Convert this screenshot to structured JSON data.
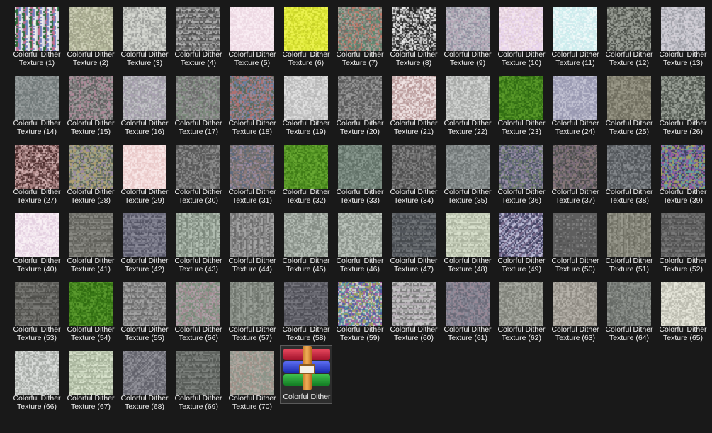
{
  "window": {
    "background": "#191919",
    "text_color": "#f0f0f0"
  },
  "files": [
    {
      "line1": "Colorful Dither",
      "line2": "Texture (1)",
      "palette": [
        "#d8d8e0",
        "#2a6b3a",
        "#c07090",
        "#7080c0",
        "#f0f0f0"
      ],
      "style": "vstripe"
    },
    {
      "line1": "Colorful Dither",
      "line2": "Texture (2)",
      "palette": [
        "#b8bca0",
        "#9ea088",
        "#cfd0b8",
        "#a8aa90"
      ],
      "style": "noise"
    },
    {
      "line1": "Colorful Dither",
      "line2": "Texture (3)",
      "palette": [
        "#c8cac4",
        "#9a9c98",
        "#d8dad4",
        "#b0b2ae"
      ],
      "style": "noise"
    },
    {
      "line1": "Colorful Dither",
      "line2": "Texture (4)",
      "palette": [
        "#8a8a8a",
        "#6a6a6a",
        "#b0b0b0",
        "#505050"
      ],
      "style": "hstripe"
    },
    {
      "line1": "Colorful Dither",
      "line2": "Texture (5)",
      "palette": [
        "#f6e6ee",
        "#f0dce6",
        "#faeef4",
        "#ecd8e2"
      ],
      "style": "noise"
    },
    {
      "line1": "Colorful Dither",
      "line2": "Texture (6)",
      "palette": [
        "#e4ee40",
        "#d6e030",
        "#eef452",
        "#c8d228"
      ],
      "style": "noise"
    },
    {
      "line1": "Colorful Dither",
      "line2": "Texture (7)",
      "palette": [
        "#8a8a80",
        "#6e7068",
        "#a6a098",
        "#c07868",
        "#5a8a70"
      ],
      "style": "noise"
    },
    {
      "line1": "Colorful Dither",
      "line2": "Texture (8)",
      "palette": [
        "#202020",
        "#f0f0f0",
        "#8a8a8a",
        "#404040",
        "#c8c8c8"
      ],
      "style": "noise"
    },
    {
      "line1": "Colorful Dither",
      "line2": "Texture (9)",
      "palette": [
        "#a8a8b0",
        "#c0c0c8",
        "#9090a0",
        "#b8a8b8"
      ],
      "style": "noise"
    },
    {
      "line1": "Colorful Dither",
      "line2": "Texture (10)",
      "palette": [
        "#ecdae6",
        "#f4e6ee",
        "#e0ccd8",
        "#e8d4ee"
      ],
      "style": "noise"
    },
    {
      "line1": "Colorful Dither",
      "line2": "Texture (11)",
      "palette": [
        "#e0f4f4",
        "#cceeee",
        "#f0fafa",
        "#d0e8ec"
      ],
      "style": "noise"
    },
    {
      "line1": "Colorful Dither",
      "line2": "Texture (12)",
      "palette": [
        "#6a6e66",
        "#8a8e86",
        "#4a4e48",
        "#a0a49c"
      ],
      "style": "noise"
    },
    {
      "line1": "Colorful Dither",
      "line2": "Texture (13)",
      "palette": [
        "#b8b8c0",
        "#c8c8d0",
        "#a0a0a8",
        "#d4d0d8"
      ],
      "style": "noise"
    },
    {
      "line1": "Colorful Dither",
      "line2": "Texture (14)",
      "palette": [
        "#8a9090",
        "#7a8080",
        "#9aa0a0",
        "#707878"
      ],
      "style": "noise"
    },
    {
      "line1": "Colorful Dither",
      "line2": "Texture (15)",
      "palette": [
        "#7a7878",
        "#9a9898",
        "#606060",
        "#b08a9a"
      ],
      "style": "noise"
    },
    {
      "line1": "Colorful Dither",
      "line2": "Texture (16)",
      "palette": [
        "#b0b0b4",
        "#9a9aa0",
        "#c4c4c8",
        "#a8a0b0"
      ],
      "style": "noise"
    },
    {
      "line1": "Colorful Dither",
      "line2": "Texture (17)",
      "palette": [
        "#828282",
        "#6c6c6c",
        "#9a9a9a",
        "#7a8a7a"
      ],
      "style": "noise"
    },
    {
      "line1": "Colorful Dither",
      "line2": "Texture (18)",
      "palette": [
        "#7a7070",
        "#5a6a5a",
        "#9a8a9a",
        "#6a80a0",
        "#b07070"
      ],
      "style": "noise"
    },
    {
      "line1": "Colorful Dither",
      "line2": "Texture (19)",
      "palette": [
        "#d0d0d0",
        "#c0c0c0",
        "#e0e0e0",
        "#b8b8b8"
      ],
      "style": "noise"
    },
    {
      "line1": "Colorful Dither",
      "line2": "Texture (20)",
      "palette": [
        "#808080",
        "#6a6a6a",
        "#9a9a9a",
        "#585858"
      ],
      "style": "noise"
    },
    {
      "line1": "Colorful Dither",
      "line2": "Texture (21)",
      "palette": [
        "#e0d0d0",
        "#c8b0b0",
        "#f0e4e4",
        "#b89898"
      ],
      "style": "noise"
    },
    {
      "line1": "Colorful Dither",
      "line2": "Texture (22)",
      "palette": [
        "#c4c6c4",
        "#b0b2b0",
        "#d4d6d4",
        "#a6a8a6"
      ],
      "style": "noise"
    },
    {
      "line1": "Colorful Dither",
      "line2": "Texture (23)",
      "palette": [
        "#4a8a20",
        "#3a7818",
        "#5a9a2a",
        "#2e6a12"
      ],
      "style": "noise"
    },
    {
      "line1": "Colorful Dither",
      "line2": "Texture (24)",
      "palette": [
        "#b0b0c4",
        "#a0a0b8",
        "#c4c4d4",
        "#9898b0"
      ],
      "style": "noise"
    },
    {
      "line1": "Colorful Dither",
      "line2": "Texture (25)",
      "palette": [
        "#8a8878",
        "#7a7868",
        "#9a9888",
        "#6e6c5e"
      ],
      "style": "noise"
    },
    {
      "line1": "Colorful Dither",
      "line2": "Texture (26)",
      "palette": [
        "#6a7068",
        "#8a9088",
        "#4e544c",
        "#a0a69c"
      ],
      "style": "noise"
    },
    {
      "line1": "Colorful Dither",
      "line2": "Texture (27)",
      "palette": [
        "#907070",
        "#b08888",
        "#6a4a4a",
        "#d0b0b0",
        "#4a2a2a"
      ],
      "style": "noise"
    },
    {
      "line1": "Colorful Dither",
      "line2": "Texture (28)",
      "palette": [
        "#7a8070",
        "#a0a890",
        "#5a6458",
        "#9a8aa0",
        "#b0a070"
      ],
      "style": "noise"
    },
    {
      "line1": "Colorful Dither",
      "line2": "Texture (29)",
      "palette": [
        "#f4dcdc",
        "#eed0d0",
        "#f8e8e8",
        "#e8c8c8"
      ],
      "style": "noise"
    },
    {
      "line1": "Colorful Dither",
      "line2": "Texture (30)",
      "palette": [
        "#787878",
        "#626262",
        "#8e8e8e",
        "#555555"
      ],
      "style": "noise"
    },
    {
      "line1": "Colorful Dither",
      "line2": "Texture (31)",
      "palette": [
        "#7a7878",
        "#5e6a7e",
        "#8e7a7a",
        "#6a6a6a",
        "#9a8aa0"
      ],
      "style": "noise"
    },
    {
      "line1": "Colorful Dither",
      "line2": "Texture (32)",
      "palette": [
        "#5a9a28",
        "#4a8a1e",
        "#6aaa34",
        "#3e7a16"
      ],
      "style": "noise"
    },
    {
      "line1": "Colorful Dither",
      "line2": "Texture (33)",
      "palette": [
        "#7a8a80",
        "#6a7a70",
        "#8a9a90",
        "#5e6e64"
      ],
      "style": "noise"
    },
    {
      "line1": "Colorful Dither",
      "line2": "Texture (34)",
      "palette": [
        "#707070",
        "#5c5c5c",
        "#868686",
        "#4c4c4c"
      ],
      "style": "noise"
    },
    {
      "line1": "Colorful Dither",
      "line2": "Texture (35)",
      "palette": [
        "#8a9090",
        "#7a8080",
        "#9aa0a0",
        "#6e7474"
      ],
      "style": "noise"
    },
    {
      "line1": "Colorful Dither",
      "line2": "Texture (36)",
      "palette": [
        "#606878",
        "#807890",
        "#4a5060",
        "#9a90a8",
        "#70806a"
      ],
      "style": "noise"
    },
    {
      "line1": "Colorful Dither",
      "line2": "Texture (37)",
      "palette": [
        "#606060",
        "#7a6a7a",
        "#4a4a4a",
        "#8a7a7a"
      ],
      "style": "noise"
    },
    {
      "line1": "Colorful Dither",
      "line2": "Texture (38)",
      "palette": [
        "#707478",
        "#5c6064",
        "#868a8e",
        "#4e5256"
      ],
      "style": "noise"
    },
    {
      "line1": "Colorful Dither",
      "line2": "Texture (39)",
      "palette": [
        "#6a60a0",
        "#a060a0",
        "#60a0a0",
        "#a0a060",
        "#404060"
      ],
      "style": "noise"
    },
    {
      "line1": "Colorful Dither",
      "line2": "Texture (40)",
      "palette": [
        "#f4e8f0",
        "#ecdcea",
        "#faf2f6",
        "#e4d0e0"
      ],
      "style": "noise"
    },
    {
      "line1": "Colorful Dither",
      "line2": "Texture (41)",
      "palette": [
        "#7a7a74",
        "#6a6a64",
        "#8a8a84",
        "#5e5e58"
      ],
      "style": "hstripe"
    },
    {
      "line1": "Colorful Dither",
      "line2": "Texture (42)",
      "palette": [
        "#686878",
        "#7a7a8a",
        "#545464",
        "#8a8a98"
      ],
      "style": "hstripe"
    },
    {
      "line1": "Colorful Dither",
      "line2": "Texture (43)",
      "palette": [
        "#a0aca0",
        "#8a968a",
        "#b4c0b4",
        "#7a867a"
      ],
      "style": "vstripe"
    },
    {
      "line1": "Colorful Dither",
      "line2": "Texture (44)",
      "palette": [
        "#909090",
        "#7a7a7a",
        "#a6a6a6",
        "#6a6a6a"
      ],
      "style": "vstripe"
    },
    {
      "line1": "Colorful Dither",
      "line2": "Texture (45)",
      "palette": [
        "#a4aca4",
        "#909890",
        "#b8c0b8",
        "#848c84"
      ],
      "style": "noise"
    },
    {
      "line1": "Colorful Dither",
      "line2": "Texture (46)",
      "palette": [
        "#a8b0a8",
        "#949c94",
        "#bcc4bc",
        "#889088"
      ],
      "style": "noise"
    },
    {
      "line1": "Colorful Dither",
      "line2": "Texture (47)",
      "palette": [
        "#606468",
        "#50545a",
        "#707478",
        "#44484c"
      ],
      "style": "hstripe"
    },
    {
      "line1": "Colorful Dither",
      "line2": "Texture (48)",
      "palette": [
        "#c8d0bc",
        "#b8c0ac",
        "#d8e0cc",
        "#aab29e"
      ],
      "style": "hstripe"
    },
    {
      "line1": "Colorful Dither",
      "line2": "Texture (49)",
      "palette": [
        "#5a5a7a",
        "#a0a0c0",
        "#3a3a5a",
        "#c0c0d8",
        "#7a6a8a"
      ],
      "style": "diag"
    },
    {
      "line1": "Colorful Dither",
      "line2": "Texture (50)",
      "palette": [
        "#707070",
        "#5e5e5e",
        "#848484",
        "#505050"
      ],
      "style": "grid"
    },
    {
      "line1": "Colorful Dither",
      "line2": "Texture (51)",
      "palette": [
        "#8a8a7e",
        "#7a7a6e",
        "#9a9a8e",
        "#6e6e62"
      ],
      "style": "vstripe"
    },
    {
      "line1": "Colorful Dither",
      "line2": "Texture (52)",
      "palette": [
        "#686868",
        "#5a5a5a",
        "#787878",
        "#4e4e4e"
      ],
      "style": "hstripe"
    },
    {
      "line1": "Colorful Dither",
      "line2": "Texture (53)",
      "palette": [
        "#6a6a66",
        "#5a5a56",
        "#7a7a76",
        "#4e4e4a"
      ],
      "style": "hstripe"
    },
    {
      "line1": "Colorful Dither",
      "line2": "Texture (54)",
      "palette": [
        "#4a8a22",
        "#3a7a18",
        "#5a9a2e",
        "#2e6a10"
      ],
      "style": "noise"
    },
    {
      "line1": "Colorful Dither",
      "line2": "Texture (55)",
      "palette": [
        "#909090",
        "#7a7a7a",
        "#a4a4a4",
        "#6a6a6a"
      ],
      "style": "hstripe"
    },
    {
      "line1": "Colorful Dither",
      "line2": "Texture (56)",
      "palette": [
        "#909a90",
        "#a08a90",
        "#7a8a7a",
        "#b0a0a8"
      ],
      "style": "noise"
    },
    {
      "line1": "Colorful Dither",
      "line2": "Texture (57)",
      "palette": [
        "#8a9088",
        "#7a8078",
        "#9aa098",
        "#6e746c"
      ],
      "style": "vstripe"
    },
    {
      "line1": "Colorful Dither",
      "line2": "Texture (58)",
      "palette": [
        "#686870",
        "#585860",
        "#787880",
        "#4c4c54"
      ],
      "style": "hstripe"
    },
    {
      "line1": "Colorful Dither",
      "line2": "Texture (59)",
      "palette": [
        "#a060a0",
        "#60a0a0",
        "#a0a060",
        "#5060a0",
        "#d0d0d0"
      ],
      "style": "noise"
    },
    {
      "line1": "Colorful Dither",
      "line2": "Texture (60)",
      "palette": [
        "#a0a0a0",
        "#c4c4c4",
        "#7a7a7a",
        "#b8b0b8"
      ],
      "style": "hstripe"
    },
    {
      "line1": "Colorful Dither",
      "line2": "Texture (61)",
      "palette": [
        "#7a7a88",
        "#6a6a78",
        "#8a8a98",
        "#9a8a98"
      ],
      "style": "noise"
    },
    {
      "line1": "Colorful Dither",
      "line2": "Texture (62)",
      "palette": [
        "#9a9c94",
        "#8a8c84",
        "#aaaca4",
        "#7e8078"
      ],
      "style": "noise"
    },
    {
      "line1": "Colorful Dither",
      "line2": "Texture (63)",
      "palette": [
        "#a8a49c",
        "#98948c",
        "#b8b4ac",
        "#8c8880"
      ],
      "style": "noise"
    },
    {
      "line1": "Colorful Dither",
      "line2": "Texture (64)",
      "palette": [
        "#808480",
        "#70746f",
        "#90948f",
        "#646864"
      ],
      "style": "noise"
    },
    {
      "line1": "Colorful Dither",
      "line2": "Texture (65)",
      "palette": [
        "#d8d8cc",
        "#c4c4b8",
        "#e8e8dc",
        "#b8b8ac"
      ],
      "style": "noise"
    },
    {
      "line1": "Colorful Dither",
      "line2": "Texture (66)",
      "palette": [
        "#c8ccc8",
        "#b4b8b4",
        "#dcdfdc",
        "#a4a8a4"
      ],
      "style": "noise"
    },
    {
      "line1": "Colorful Dither",
      "line2": "Texture (67)",
      "palette": [
        "#c4d0b8",
        "#b0bca4",
        "#d8e2cc",
        "#a4b098"
      ],
      "style": "hstripe"
    },
    {
      "line1": "Colorful Dither",
      "line2": "Texture (68)",
      "palette": [
        "#808088",
        "#6c6c74",
        "#94949c",
        "#60606a"
      ],
      "style": "diag"
    },
    {
      "line1": "Colorful Dither",
      "line2": "Texture (69)",
      "palette": [
        "#707470",
        "#606460",
        "#808480",
        "#545854"
      ],
      "style": "hstripe"
    },
    {
      "line1": "Colorful Dither",
      "line2": "Texture (70)",
      "palette": [
        "#9a9c94",
        "#a09088",
        "#8a9488",
        "#b0a8a0"
      ],
      "style": "noise"
    }
  ],
  "archive": {
    "line1": "Colorful Dither",
    "line2": "",
    "icon": "archive-books-icon",
    "selected": true
  }
}
